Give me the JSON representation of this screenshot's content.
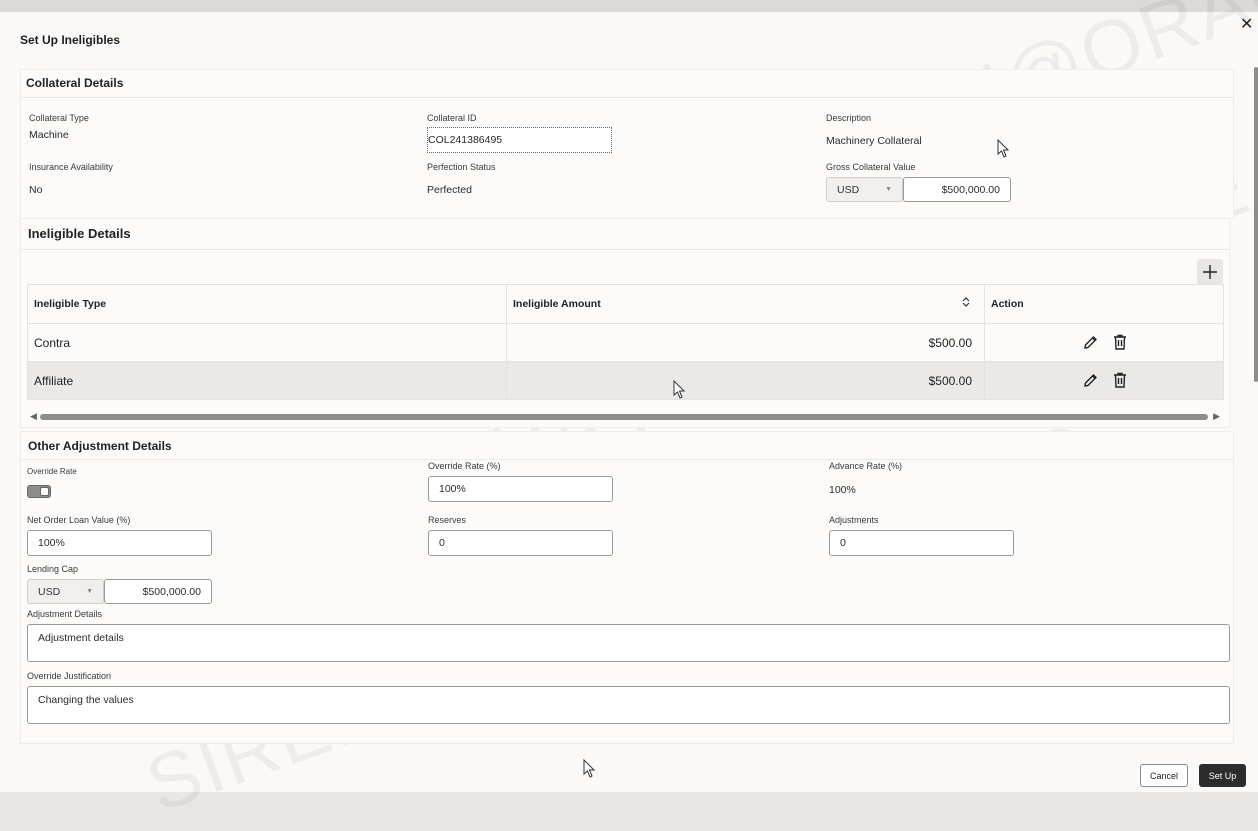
{
  "dialog": {
    "title": "Set Up Ineligibles",
    "close_icon": "close-icon"
  },
  "collateral": {
    "section_title": "Collateral Details",
    "type_label": "Collateral Type",
    "type_value": "Machine",
    "id_label": "Collateral ID",
    "id_value": "COL241386495",
    "description_label": "Description",
    "description_value": "Machinery Collateral",
    "insurance_label": "Insurance Availability",
    "insurance_value": "No",
    "perfection_label": "Perfection Status",
    "perfection_value": "Perfected",
    "gross_label": "Gross Collateral Value",
    "gross_currency": "USD",
    "gross_value": "$500,000.00"
  },
  "ineligible": {
    "section_title": "Ineligible Details",
    "add_icon": "plus-icon",
    "columns": [
      "Ineligible Type",
      "Ineligible Amount",
      "Action"
    ],
    "sort_icon": "sort-icon",
    "rows": [
      {
        "type": "Contra",
        "amount": "$500.00"
      },
      {
        "type": "Affiliate",
        "amount": "$500.00"
      }
    ],
    "edit_icon": "pencil-icon",
    "delete_icon": "trash-icon"
  },
  "other": {
    "section_title": "Other Adjustment Details",
    "override_toggle_label": "Override Rate",
    "override_rate_label": "Override Rate (%)",
    "override_rate_value": "100%",
    "advance_rate_label": "Advance Rate (%)",
    "advance_rate_value": "100%",
    "nolv_label": "Net Order Loan Value (%)",
    "nolv_value": "100%",
    "reserves_label": "Reserves",
    "reserves_value": "0",
    "adjustments_label": "Adjustments",
    "adjustments_value": "0",
    "lending_cap_label": "Lending Cap",
    "lending_cap_currency": "USD",
    "lending_cap_value": "$500,000.00",
    "adjustment_details_label": "Adjustment Details",
    "adjustment_details_value": "Adjustment details",
    "override_justification_label": "Override Justification",
    "override_justification_value": "Changing the values"
  },
  "footer": {
    "cancel_label": "Cancel",
    "setup_label": "Set Up"
  }
}
